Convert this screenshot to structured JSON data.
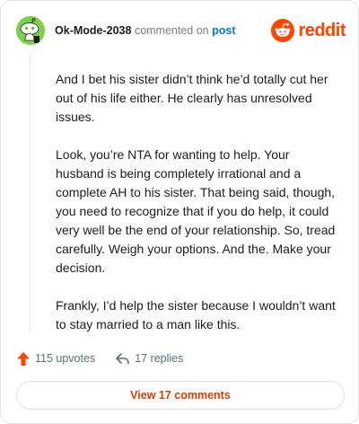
{
  "comment": {
    "username": "Ok-Mode-2038",
    "commented_on_text": "commented on",
    "post_link_text": "post",
    "brand": "reddit",
    "paragraphs": [
      "And I bet his sister didn’t think he’d totally cut her out of his life either. He clearly has unresolved issues.",
      "Look, you’re NTA for wanting to help. Your husband is being completely irrational and a complete AH to his sister. That being said, though, you need to recognize that if you do help, it could very well be the end of your relationship. So, tread carefully. Weigh your options. And the. Make your decision.",
      "Frankly, I’d help the sister because I wouldn’t want to stay married to a man like this."
    ]
  },
  "actions": {
    "upvotes_label": "115 upvotes",
    "replies_label": "17 replies",
    "view_comments_label": "View 17 comments"
  },
  "colors": {
    "brand": "#ff4500",
    "link": "#0079d3",
    "avatar": "#7ed04b",
    "view_button_text": "#d93a00"
  },
  "icons": {
    "avatar": "snoo-avatar-icon",
    "logo": "reddit-logo-icon",
    "upvote": "upvote-arrow-icon",
    "reply": "reply-arrow-icon"
  }
}
